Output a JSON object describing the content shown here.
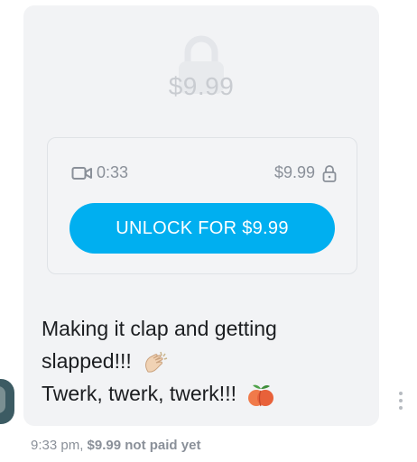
{
  "post": {
    "blurred_price": "$9.99",
    "video_duration": "0:33",
    "price": "$9.99",
    "unlock_label": "UNLOCK FOR $9.99",
    "message_line1": "Making it clap and getting",
    "message_line2": "slapped!!!",
    "message_line3": "Twerk, twerk, twerk!!!",
    "emoji1": "clapping-hands",
    "emoji2": "peach"
  },
  "footer": {
    "time": "9:33 pm,",
    "price": "$9.99",
    "status": "not paid yet"
  },
  "colors": {
    "accent": "#00aff0",
    "card_bg": "#f2f3f5",
    "muted_text": "#8a9099"
  }
}
